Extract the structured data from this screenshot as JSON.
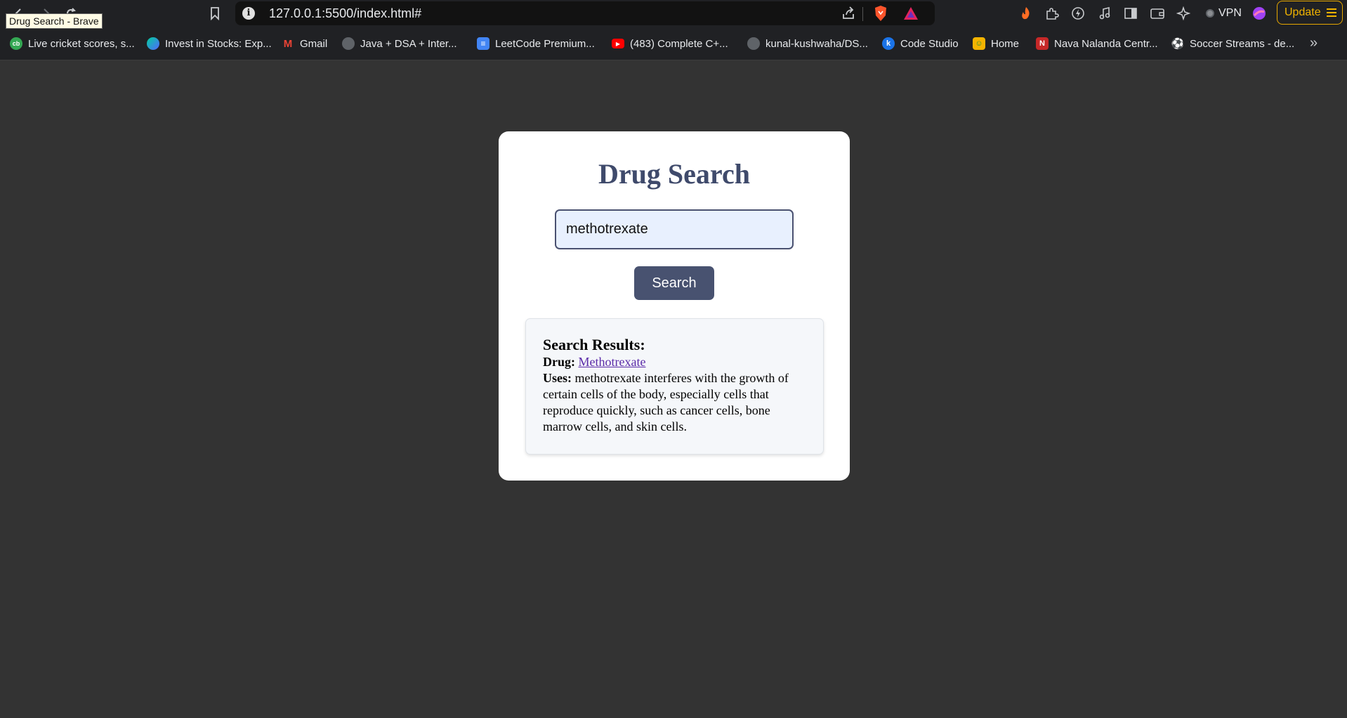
{
  "browser": {
    "tooltip": "Drug Search - Brave",
    "url": "127.0.0.1:5500/index.html#",
    "vpn_label": "VPN",
    "update_label": "Update"
  },
  "bookmarks": [
    {
      "label": "Live cricket scores, s...",
      "icon": "cricbuzz-icon",
      "color": "#34a853",
      "glyph": "cb"
    },
    {
      "label": "Invest in Stocks: Exp...",
      "icon": "groww-icon",
      "color": "#5367ff",
      "glyph": ""
    },
    {
      "label": "Gmail",
      "icon": "gmail-icon",
      "color": "#ea4335",
      "glyph": "M"
    },
    {
      "label": "Java + DSA + Inter...",
      "icon": "globe-icon",
      "color": "#5f6368",
      "glyph": ""
    },
    {
      "label": "LeetCode Premium...",
      "icon": "docs-icon",
      "color": "#4285f4",
      "glyph": "≡"
    },
    {
      "label": "(483) Complete C+...",
      "icon": "youtube-icon",
      "color": "#ff0000",
      "glyph": "▶"
    },
    {
      "label": "kunal-kushwaha/DS...",
      "icon": "github-icon",
      "color": "#5f6368",
      "glyph": ""
    },
    {
      "label": "Code Studio",
      "icon": "codestudio-icon",
      "color": "#1a73e8",
      "glyph": "k"
    },
    {
      "label": "Home",
      "icon": "classroom-icon",
      "color": "#f4b400",
      "glyph": "☺"
    },
    {
      "label": "Nava Nalanda Centr...",
      "icon": "school-icon",
      "color": "#c62828",
      "glyph": "N"
    },
    {
      "label": "Soccer Streams - de...",
      "icon": "soccer-icon",
      "color": "#9e9e9e",
      "glyph": "⚽"
    }
  ],
  "page": {
    "title": "Drug Search",
    "search_value": "methotrexate",
    "search_button": "Search",
    "results_heading": "Search Results:",
    "drug_label": "Drug:",
    "drug_name": "Methotrexate",
    "uses_label": "Uses:",
    "uses_text": "methotrexate interferes with the growth of certain cells of the body, especially cells that reproduce quickly, such as cancer cells, bone marrow cells, and skin cells."
  },
  "colors": {
    "page_bg": "#333333",
    "title": "#3f4a6b",
    "button_bg": "#485270",
    "input_bg": "#e8f0fe",
    "link": "#5a2aa8",
    "update_accent": "#f2b400"
  }
}
